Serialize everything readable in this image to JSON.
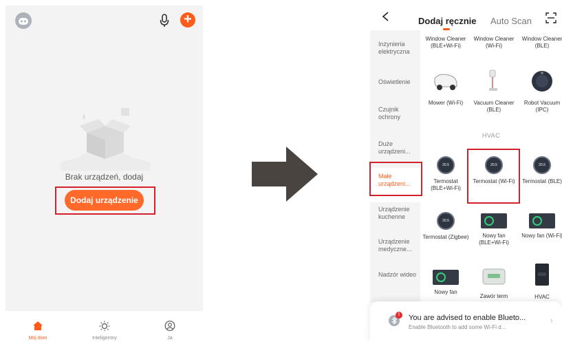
{
  "left": {
    "empty_text": "Brak urządzeń, dodaj",
    "add_button": "Dodaj urządzenie",
    "plus": "+",
    "tabs": [
      {
        "label": "Mój dom",
        "icon": "home-icon"
      },
      {
        "label": "Inteligentny",
        "icon": "sun-icon"
      },
      {
        "label": "Ja",
        "icon": "user-icon"
      }
    ]
  },
  "right": {
    "tab_manual": "Dodaj ręcznie",
    "tab_auto": "Auto Scan",
    "side_menu": [
      "Inżynieria elektryczna",
      "Oświetlenie",
      "Czujnik ochrony",
      "Duże urządzeni...",
      "Małe urządzeni...",
      "Urządzenie kuchenne",
      "Urządzenie medyczne...",
      "Nadzór wideo"
    ],
    "section": "HVAC",
    "devices": [
      {
        "label": "Window Cleaner (BLE+Wi-Fi)"
      },
      {
        "label": "Window Cleaner (Wi-Fi)"
      },
      {
        "label": "Window Cleaner (BLE)"
      },
      {
        "label": "Mower (Wi-Fi)"
      },
      {
        "label": "Vacuum Cleaner (BLE)"
      },
      {
        "label": "Robot Vacuum (IPC)"
      },
      {
        "label": "Termostat (BLE+Wi-Fi)"
      },
      {
        "label": "Termostat (Wi-Fi)"
      },
      {
        "label": "Termostat (BLE)"
      },
      {
        "label": "Termostat (Zigbee)"
      },
      {
        "label": "Nowy fan (BLE+Wi-Fi)"
      },
      {
        "label": "Nowy fan (Wi-Fi)"
      },
      {
        "label": "Nowy fan"
      },
      {
        "label": "Zawór term"
      },
      {
        "label": "HVAC"
      }
    ],
    "thermo_reading": "20.5",
    "bluetooth": {
      "badge": "!",
      "title": "You are advised to enable Blueto...",
      "subtitle": "Enable Bluetooth to add some Wi-Fi d..."
    }
  },
  "colors": {
    "accent": "#ff5c1c",
    "highlight_box": "#d4202a"
  }
}
